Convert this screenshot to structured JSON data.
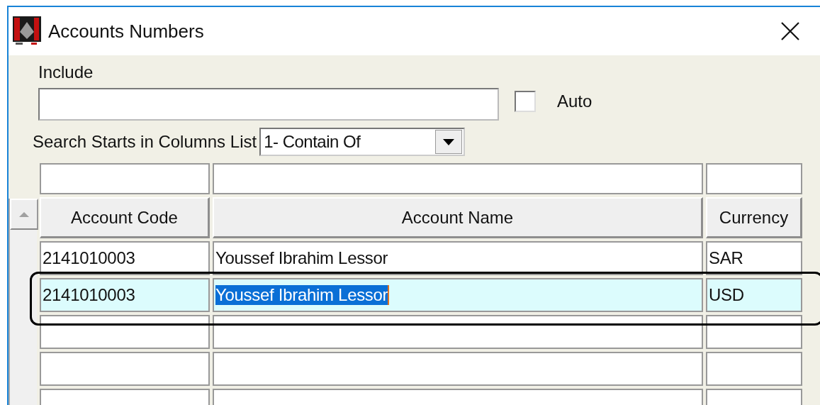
{
  "window": {
    "title": "Accounts Numbers"
  },
  "include": {
    "label": "Include"
  },
  "auto": {
    "label": "Auto",
    "checked": false
  },
  "search": {
    "label": "Search Starts in Columns List",
    "value": "1- Contain Of"
  },
  "table": {
    "columns": [
      "Account Code",
      "Account Name",
      "Currency"
    ],
    "rows": [
      {
        "cells": [
          "2141010003",
          "Youssef Ibrahim Lessor",
          "SAR"
        ],
        "selected": false,
        "outlined": false
      },
      {
        "cells": [
          "2141010003",
          "Youssef Ibrahim Lessor",
          "USD"
        ],
        "selected": true,
        "outlined": true
      }
    ]
  }
}
